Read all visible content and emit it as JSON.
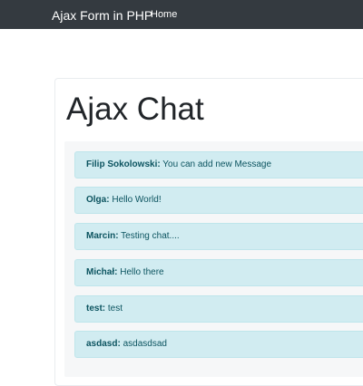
{
  "navbar": {
    "brand": "Ajax Form in PHP",
    "links": [
      {
        "label": "Home"
      }
    ]
  },
  "page": {
    "title": "Ajax Chat"
  },
  "messages": [
    {
      "author": "Filip Sokolowski:",
      "text": "You can add new Message"
    },
    {
      "author": "Olga:",
      "text": "Hello World!"
    },
    {
      "author": "Marcin:",
      "text": "Testing chat...."
    },
    {
      "author": "Michał:",
      "text": "Hello there"
    },
    {
      "author": "test:",
      "text": "test"
    },
    {
      "author": "asdasd:",
      "text": "asdasdsad"
    }
  ],
  "colors": {
    "navbar_bg": "#343a40",
    "message_bg": "#d1ecf1",
    "message_text": "#0c5460"
  }
}
